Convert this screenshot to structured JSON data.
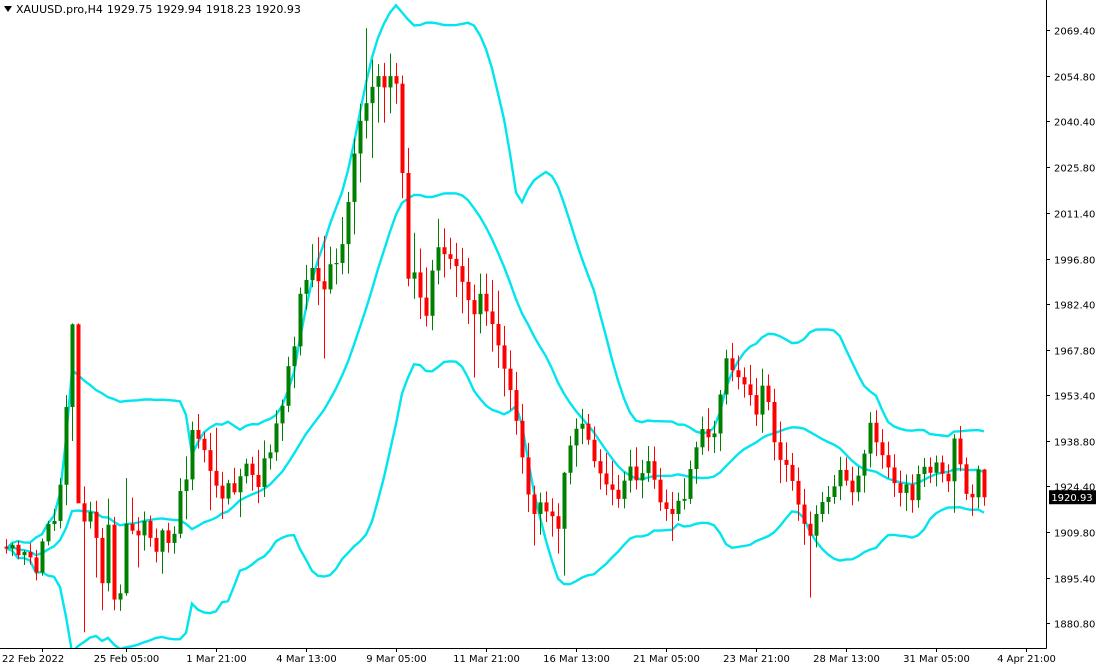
{
  "chart": {
    "symbol": "XAUUSD.pro,H4",
    "ohlc": [
      "1929.75",
      "1929.94",
      "1918.23",
      "1920.93"
    ],
    "current_price_label": "1920.93"
  },
  "colors": {
    "bull": "#008000",
    "bear": "#ff0000",
    "bands": "#00e5ee",
    "axis": "#000000",
    "price_box_bg": "#000000",
    "price_box_text": "#ffffff"
  },
  "chart_data": {
    "type": "candlestick",
    "title": "XAUUSD.pro,H4",
    "ylim": [
      1873,
      2079
    ],
    "y_ticks": [
      1880.8,
      1895.4,
      1909.8,
      1924.4,
      1938.8,
      1953.4,
      1967.8,
      1982.4,
      1996.8,
      2011.4,
      2025.8,
      2040.4,
      2054.8,
      2069.4
    ],
    "y_tick_labels": [
      "1880.80",
      "1895.40",
      "1909.80",
      "1924.40",
      "1938.80",
      "1953.40",
      "1967.80",
      "1982.40",
      "1996.80",
      "2011.40",
      "2025.80",
      "2040.40",
      "2054.80",
      "2069.40"
    ],
    "x_ticks": [
      {
        "index": 6,
        "label": "22 Feb 2022"
      },
      {
        "index": 20,
        "label": "25 Feb 05:00"
      },
      {
        "index": 35,
        "label": "1 Mar 21:00"
      },
      {
        "index": 50,
        "label": "4 Mar 13:00"
      },
      {
        "index": 65,
        "label": "9 Mar 05:00"
      },
      {
        "index": 80,
        "label": "11 Mar 21:00"
      },
      {
        "index": 95,
        "label": "16 Mar 13:00"
      },
      {
        "index": 110,
        "label": "21 Mar 05:00"
      },
      {
        "index": 125,
        "label": "23 Mar 21:00"
      },
      {
        "index": 140,
        "label": "28 Mar 13:00"
      },
      {
        "index": 155,
        "label": "31 Mar 05:00"
      },
      {
        "index": 170,
        "label": "4 Apr 21:00"
      }
    ],
    "candles": [
      [
        1905.2,
        1907.6,
        1903,
        1904.6
      ],
      [
        1904.6,
        1906.4,
        1902.2,
        1905.8
      ],
      [
        1905.8,
        1907.0,
        1901.2,
        1902.5
      ],
      [
        1902.5,
        1904.1,
        1899.4,
        1903.5
      ],
      [
        1903.5,
        1906.3,
        1899.5,
        1901.8
      ],
      [
        1901.8,
        1904.2,
        1894.5,
        1897.0
      ],
      [
        1897.0,
        1907.8,
        1896.0,
        1906.9
      ],
      [
        1906.9,
        1913.4,
        1905.6,
        1912.4
      ],
      [
        1912.4,
        1917.2,
        1910.2,
        1913.4
      ],
      [
        1913.4,
        1927.0,
        1911.0,
        1924.9
      ],
      [
        1924.9,
        1953.4,
        1918.4,
        1949.6
      ],
      [
        1949.6,
        1976.2,
        1938.8,
        1975.9
      ],
      [
        1975.9,
        1976.2,
        1931.0,
        1919.0
      ],
      [
        1919.0,
        1924.4,
        1878.0,
        1913.2
      ],
      [
        1913.2,
        1919.5,
        1911.0,
        1916.3
      ],
      [
        1916.3,
        1919.8,
        1895.4,
        1908.0
      ],
      [
        1908.0,
        1911.2,
        1885.0,
        1893.6
      ],
      [
        1893.6,
        1920.5,
        1891.0,
        1912.2
      ],
      [
        1912.2,
        1914.7,
        1885.0,
        1888.4
      ],
      [
        1888.4,
        1893.2,
        1884.8,
        1890.4
      ],
      [
        1890.4,
        1927.0,
        1889.6,
        1912.5
      ],
      [
        1912.5,
        1920.8,
        1909.2,
        1910.3
      ],
      [
        1910.3,
        1914.6,
        1898.6,
        1908.8
      ],
      [
        1908.8,
        1916.4,
        1904.0,
        1913.4
      ],
      [
        1913.4,
        1915.1,
        1905.2,
        1908.0
      ],
      [
        1908.0,
        1911.0,
        1900.2,
        1903.6
      ],
      [
        1903.6,
        1911.0,
        1896.6,
        1910.4
      ],
      [
        1910.4,
        1912.8,
        1903.3,
        1906.4
      ],
      [
        1906.4,
        1911.7,
        1903.0,
        1909.3
      ],
      [
        1909.3,
        1927.0,
        1907.9,
        1922.9
      ],
      [
        1922.9,
        1933.9,
        1913.9,
        1926.6
      ],
      [
        1926.6,
        1945.0,
        1923.2,
        1942.3
      ],
      [
        1942.3,
        1947.4,
        1936.4,
        1939.5
      ],
      [
        1939.5,
        1941.6,
        1932.0,
        1935.9
      ],
      [
        1935.9,
        1941.4,
        1916.8,
        1929.3
      ],
      [
        1929.3,
        1943.0,
        1920.8,
        1924.6
      ],
      [
        1924.6,
        1929.0,
        1914.0,
        1920.5
      ],
      [
        1920.5,
        1926.5,
        1918.6,
        1925.4
      ],
      [
        1925.4,
        1930.3,
        1921.8,
        1922.5
      ],
      [
        1922.5,
        1930.0,
        1914.6,
        1927.6
      ],
      [
        1927.6,
        1933.2,
        1925.3,
        1931.6
      ],
      [
        1931.6,
        1933.8,
        1923.0,
        1928.0
      ],
      [
        1928.0,
        1936.0,
        1919.0,
        1924.2
      ],
      [
        1924.2,
        1939.0,
        1921.0,
        1933.3
      ],
      [
        1933.3,
        1937.7,
        1929.7,
        1935.2
      ],
      [
        1935.2,
        1948.6,
        1932.5,
        1944.4
      ],
      [
        1944.4,
        1952.0,
        1938.8,
        1950.0
      ],
      [
        1950.0,
        1965.6,
        1948.0,
        1962.6
      ],
      [
        1962.6,
        1972.0,
        1955.6,
        1968.9
      ],
      [
        1968.9,
        1987.6,
        1966.0,
        1985.6
      ],
      [
        1985.6,
        1994.8,
        1980.6,
        1990.0
      ],
      [
        1990.0,
        2001.4,
        1987.7,
        1993.8
      ],
      [
        1993.8,
        2003.6,
        1982.0,
        1989.6
      ],
      [
        1989.6,
        2004.0,
        1965.0,
        1987.0
      ],
      [
        1987.0,
        2000.6,
        1985.6,
        1995.0
      ],
      [
        1995.0,
        2000.0,
        1988.6,
        1995.4
      ],
      [
        1995.4,
        2010.0,
        1991.8,
        2001.4
      ],
      [
        2001.4,
        2018.0,
        1992.0,
        2014.8
      ],
      [
        2014.8,
        2035.0,
        2004.5,
        2030.2
      ],
      [
        2030.2,
        2046.0,
        2021.0,
        2040.6
      ],
      [
        2040.6,
        2070.0,
        2035.0,
        2046.2
      ],
      [
        2046.2,
        2060.0,
        2028.8,
        2051.4
      ],
      [
        2051.4,
        2058.6,
        2040.0,
        2054.8
      ],
      [
        2054.8,
        2059.0,
        2040.0,
        2051.2
      ],
      [
        2051.2,
        2062.0,
        2043.0,
        2054.8
      ],
      [
        2054.8,
        2059.0,
        2046.0,
        2052.4
      ],
      [
        2052.4,
        2055.0,
        2016.0,
        2024.0
      ],
      [
        2024.0,
        2032.0,
        1988.0,
        1990.4
      ],
      [
        1990.4,
        2005.0,
        1984.0,
        1992.4
      ],
      [
        1992.4,
        2000.0,
        1977.6,
        1984.4
      ],
      [
        1984.4,
        1994.0,
        1975.2,
        1978.6
      ],
      [
        1978.6,
        1996.4,
        1974.0,
        1993.0
      ],
      [
        1993.0,
        2009.4,
        1988.6,
        2000.4
      ],
      [
        2000.4,
        2006.4,
        1990.8,
        1998.2
      ],
      [
        1998.2,
        2003.4,
        1993.4,
        1996.7
      ],
      [
        1996.7,
        2001.8,
        1984.6,
        1994.4
      ],
      [
        1994.4,
        2000.2,
        1979.4,
        1989.4
      ],
      [
        1989.4,
        1997.0,
        1976.0,
        1983.6
      ],
      [
        1983.6,
        1988.5,
        1959.0,
        1979.1
      ],
      [
        1979.1,
        1992.0,
        1973.0,
        1985.6
      ],
      [
        1985.6,
        1992.0,
        1975.4,
        1980.0
      ],
      [
        1980.0,
        1990.0,
        1967.2,
        1976.0
      ],
      [
        1976.0,
        1986.6,
        1962.0,
        1969.2
      ],
      [
        1969.2,
        1975.4,
        1953.0,
        1961.8
      ],
      [
        1961.8,
        1967.6,
        1948.6,
        1955.0
      ],
      [
        1955.0,
        1960.8,
        1940.8,
        1945.2
      ],
      [
        1945.2,
        1950.6,
        1928.4,
        1933.6
      ],
      [
        1933.6,
        1938.2,
        1916.2,
        1921.8
      ],
      [
        1921.8,
        1924.6,
        1905.6,
        1915.6
      ],
      [
        1915.6,
        1922.4,
        1909.0,
        1919.3
      ],
      [
        1919.3,
        1922.8,
        1913.0,
        1916.4
      ],
      [
        1916.4,
        1920.6,
        1908.4,
        1914.9
      ],
      [
        1914.9,
        1919.0,
        1903.0,
        1910.9
      ],
      [
        1910.9,
        1929.0,
        1896.0,
        1928.7
      ],
      [
        1928.7,
        1940.4,
        1925.0,
        1937.4
      ],
      [
        1937.4,
        1946.0,
        1930.6,
        1942.7
      ],
      [
        1942.7,
        1949.0,
        1937.8,
        1944.3
      ],
      [
        1944.3,
        1947.4,
        1937.6,
        1939.2
      ],
      [
        1939.2,
        1943.4,
        1930.4,
        1932.4
      ],
      [
        1932.4,
        1936.2,
        1923.4,
        1928.5
      ],
      [
        1928.5,
        1935.0,
        1921.6,
        1925.0
      ],
      [
        1925.0,
        1932.4,
        1918.4,
        1923.3
      ],
      [
        1923.3,
        1928.0,
        1917.6,
        1920.4
      ],
      [
        1920.4,
        1929.0,
        1917.4,
        1926.2
      ],
      [
        1926.2,
        1936.0,
        1922.4,
        1930.7
      ],
      [
        1930.7,
        1936.8,
        1923.4,
        1926.3
      ],
      [
        1926.3,
        1932.8,
        1920.6,
        1928.6
      ],
      [
        1928.6,
        1937.2,
        1925.8,
        1932.4
      ],
      [
        1932.4,
        1937.0,
        1923.6,
        1926.5
      ],
      [
        1926.5,
        1930.2,
        1916.6,
        1919.3
      ],
      [
        1919.3,
        1923.4,
        1913.4,
        1917.2
      ],
      [
        1917.2,
        1922.6,
        1907.0,
        1915.6
      ],
      [
        1915.6,
        1922.4,
        1913.4,
        1919.8
      ],
      [
        1919.8,
        1927.0,
        1917.0,
        1920.4
      ],
      [
        1920.4,
        1932.6,
        1918.8,
        1929.9
      ],
      [
        1929.9,
        1938.6,
        1925.2,
        1936.8
      ],
      [
        1936.8,
        1946.6,
        1934.4,
        1942.6
      ],
      [
        1942.6,
        1949.2,
        1935.6,
        1940.0
      ],
      [
        1940.0,
        1945.2,
        1935.0,
        1941.2
      ],
      [
        1941.2,
        1955.0,
        1935.6,
        1953.6
      ],
      [
        1953.6,
        1967.8,
        1950.4,
        1965.1
      ],
      [
        1965.1,
        1970.0,
        1957.8,
        1961.3
      ],
      [
        1961.3,
        1966.0,
        1955.2,
        1959.1
      ],
      [
        1959.1,
        1962.2,
        1952.6,
        1956.8
      ],
      [
        1956.8,
        1963.0,
        1950.0,
        1953.4
      ],
      [
        1953.4,
        1958.8,
        1943.6,
        1947.2
      ],
      [
        1947.2,
        1961.8,
        1941.4,
        1956.4
      ],
      [
        1956.4,
        1960.0,
        1948.6,
        1951.2
      ],
      [
        1951.2,
        1955.4,
        1932.6,
        1938.4
      ],
      [
        1938.4,
        1945.0,
        1925.4,
        1932.8
      ],
      [
        1932.8,
        1938.4,
        1925.8,
        1931.2
      ],
      [
        1931.2,
        1935.0,
        1923.0,
        1926.1
      ],
      [
        1926.1,
        1930.4,
        1913.4,
        1918.6
      ],
      [
        1918.6,
        1923.6,
        1905.8,
        1912.5
      ],
      [
        1912.5,
        1916.4,
        1889.0,
        1908.7
      ],
      [
        1908.7,
        1918.4,
        1905.0,
        1915.6
      ],
      [
        1915.6,
        1922.6,
        1913.0,
        1919.4
      ],
      [
        1919.4,
        1924.5,
        1915.6,
        1921.0
      ],
      [
        1921.0,
        1928.0,
        1918.8,
        1924.4
      ],
      [
        1924.4,
        1933.8,
        1920.0,
        1929.6
      ],
      [
        1929.6,
        1933.6,
        1924.6,
        1926.2
      ],
      [
        1926.2,
        1930.6,
        1918.4,
        1922.5
      ],
      [
        1922.5,
        1930.6,
        1919.6,
        1927.8
      ],
      [
        1927.8,
        1936.0,
        1922.4,
        1934.8
      ],
      [
        1934.8,
        1948.0,
        1930.4,
        1944.6
      ],
      [
        1944.6,
        1948.6,
        1934.0,
        1938.4
      ],
      [
        1938.4,
        1942.6,
        1930.0,
        1934.3
      ],
      [
        1934.3,
        1938.6,
        1927.0,
        1930.4
      ],
      [
        1930.4,
        1934.6,
        1921.0,
        1925.4
      ],
      [
        1925.4,
        1929.4,
        1918.0,
        1922.3
      ],
      [
        1922.3,
        1928.2,
        1916.6,
        1925.0
      ],
      [
        1925.0,
        1928.2,
        1916.0,
        1920.0
      ],
      [
        1920.0,
        1931.0,
        1917.6,
        1928.3
      ],
      [
        1928.3,
        1933.4,
        1924.2,
        1930.6
      ],
      [
        1930.6,
        1933.6,
        1925.4,
        1928.7
      ],
      [
        1928.7,
        1934.2,
        1924.4,
        1932.0
      ],
      [
        1932.0,
        1934.2,
        1925.6,
        1928.4
      ],
      [
        1928.4,
        1931.4,
        1922.6,
        1926.0
      ],
      [
        1926.0,
        1941.0,
        1916.0,
        1939.6
      ],
      [
        1939.6,
        1943.6,
        1929.2,
        1931.4
      ],
      [
        1931.4,
        1933.6,
        1920.0,
        1922.0
      ],
      [
        1922.0,
        1925.0,
        1915.0,
        1920.9
      ],
      [
        1920.9,
        1931.0,
        1917.4,
        1929.75
      ],
      [
        1929.75,
        1929.94,
        1918.23,
        1920.93
      ]
    ]
  }
}
